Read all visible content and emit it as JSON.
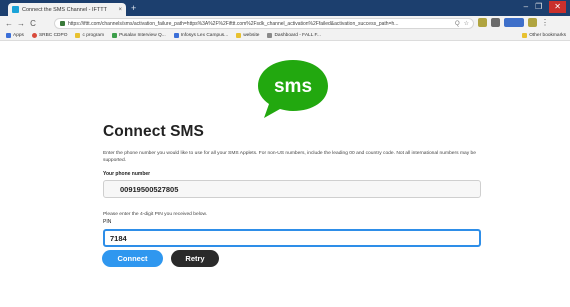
{
  "browser": {
    "tab_title": "Connect the SMS Channel - IFTTT",
    "tab_close": "×",
    "new_tab": "+",
    "window_controls": [
      "–",
      "❐",
      "✕"
    ],
    "nav": {
      "back": "←",
      "forward": "→",
      "reload": "C"
    },
    "url": "https://ifttt.com/channels/sms/activation_failure_path=https%3A%2F%2Fifttt.com%2Fsdk_channel_activation%2Ffailed&activation_success_path=h...",
    "omnibox_icons": [
      "Q",
      "☆"
    ],
    "bookmarks": [
      {
        "label": "Apps",
        "color": "#3b6fd8"
      },
      {
        "label": "SRBC CDPO",
        "color": "#d84a3b"
      },
      {
        "label": "c program",
        "color": "#e8c12f"
      },
      {
        "label": "Pusalav Interview Q...",
        "color": "#3c9e4a"
      },
      {
        "label": "Infosys Lex Campus...",
        "color": "#3b6fd8"
      },
      {
        "label": "website",
        "color": "#e8c12f"
      },
      {
        "label": "Dashboard - FALL F...",
        "color": "#8a8a8a"
      }
    ],
    "other_bookmarks": "Other bookmarks"
  },
  "sms_logo": {
    "text": "sms",
    "color": "#22a80f"
  },
  "page": {
    "title": "Connect SMS",
    "intro": "Enter the phone number you would like to use for all your SMS Applets. For non-US numbers, include the leading 00 and country code. Not all international numbers may be supported.",
    "phone_label": "Your phone number",
    "phone_value": "00919500527805",
    "pin_help": "Please enter the 4-digit PIN you received below.",
    "pin_label": "PIN",
    "pin_value": "7184",
    "connect_label": "Connect",
    "retry_label": "Retry"
  },
  "colors": {
    "connect_button": "#2f97ef",
    "retry_button": "#2a2a2a",
    "focused_input_border": "#2e8ee8",
    "titlebar": "#1c3f6e"
  }
}
